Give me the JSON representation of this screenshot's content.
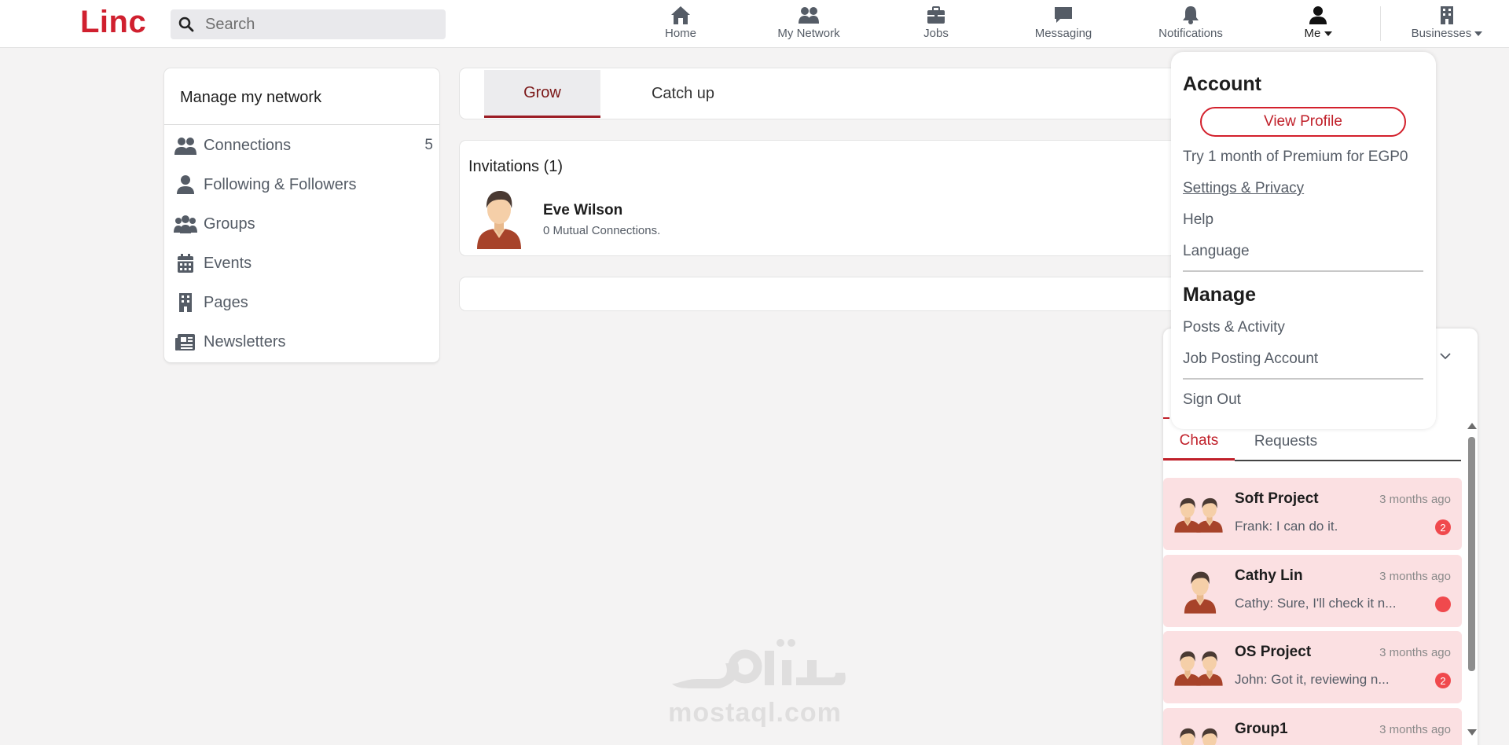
{
  "brand": {
    "logo": "Linc",
    "accent": "#d0202f"
  },
  "search": {
    "placeholder": "Search",
    "icon": "search-icon"
  },
  "nav": [
    {
      "label": "Home",
      "icon": "home-icon"
    },
    {
      "label": "My Network",
      "icon": "network-icon"
    },
    {
      "label": "Jobs",
      "icon": "briefcase-icon"
    },
    {
      "label": "Messaging",
      "icon": "message-icon"
    },
    {
      "label": "Notifications",
      "icon": "bell-icon"
    },
    {
      "label": "Me",
      "icon": "user-icon"
    },
    {
      "label": "Businesses",
      "icon": "building-icon"
    }
  ],
  "network": {
    "title": "Manage my network",
    "items": [
      {
        "label": "Connections",
        "count": "5",
        "icon": "people-icon"
      },
      {
        "label": "Following & Followers",
        "icon": "person-icon"
      },
      {
        "label": "Groups",
        "icon": "group-icon"
      },
      {
        "label": "Events",
        "icon": "calendar-icon"
      },
      {
        "label": "Pages",
        "icon": "building-icon"
      },
      {
        "label": "Newsletters",
        "icon": "newspaper-icon"
      }
    ]
  },
  "tabs": {
    "grow": "Grow",
    "catchup": "Catch up"
  },
  "invitations": {
    "heading": "Invitations (1)",
    "items": [
      {
        "name": "Eve Wilson",
        "mutual": "0 Mutual Connections."
      }
    ]
  },
  "dropdown": {
    "account_heading": "Account",
    "view_profile": "View Profile",
    "premium": "Try 1 month of Premium for EGP0",
    "settings": "Settings & Privacy",
    "help": "Help",
    "language": "Language",
    "manage_heading": "Manage",
    "posts": "Posts & Activity",
    "job_posting": "Job Posting Account",
    "sign_out": "Sign Out"
  },
  "messaging": {
    "tabs": {
      "chats": "Chats",
      "requests": "Requests"
    },
    "chats": [
      {
        "name": "Soft Project",
        "time": "3 months ago",
        "preview": "Frank: I can do it.",
        "badge": "2"
      },
      {
        "name": "Cathy Lin",
        "time": "3 months ago",
        "preview": "Cathy: Sure, I'll check it n...",
        "badge": ""
      },
      {
        "name": "OS Project",
        "time": "3 months ago",
        "preview": "John: Got it, reviewing n...",
        "badge": "2"
      },
      {
        "name": "Group1",
        "time": "3 months ago",
        "preview": "",
        "badge": ""
      }
    ]
  },
  "watermark": {
    "text": "mostaql.com"
  }
}
